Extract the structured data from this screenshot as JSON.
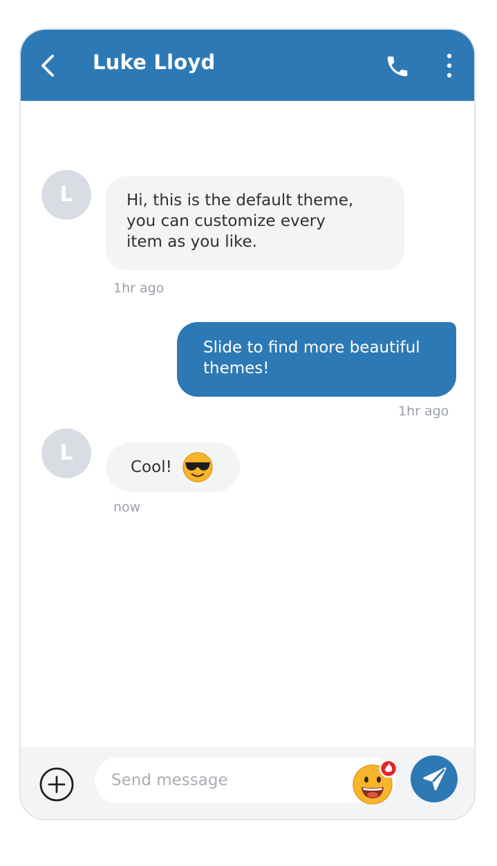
{
  "header": {
    "title": "Luke Lloyd",
    "back_icon": "chevron-left-icon",
    "call_icon": "phone-icon",
    "more_icon": "more-vertical-icon"
  },
  "messages": [
    {
      "direction": "incoming",
      "avatar_initial": "L",
      "lines": [
        "Hi, this is the default theme,",
        "you can customize every",
        "item as you like."
      ],
      "time": "1hr ago"
    },
    {
      "direction": "outgoing",
      "lines": [
        "Slide to find more beautiful",
        "themes!"
      ],
      "time": "1hr ago"
    },
    {
      "direction": "incoming",
      "avatar_initial": "L",
      "text": "Cool!",
      "emoji": "sunglasses-emoji",
      "time": "now"
    }
  ],
  "composer": {
    "placeholder": "Send message",
    "add_icon": "plus-circle-icon",
    "emoji_icon": "grinning-emoji-with-badge",
    "send_icon": "send-icon"
  },
  "colors": {
    "accent": "#2d79b5",
    "incoming_bubble": "#f3f4f6",
    "avatar": "#d8dde4",
    "timestamp": "#9aa0a8"
  }
}
